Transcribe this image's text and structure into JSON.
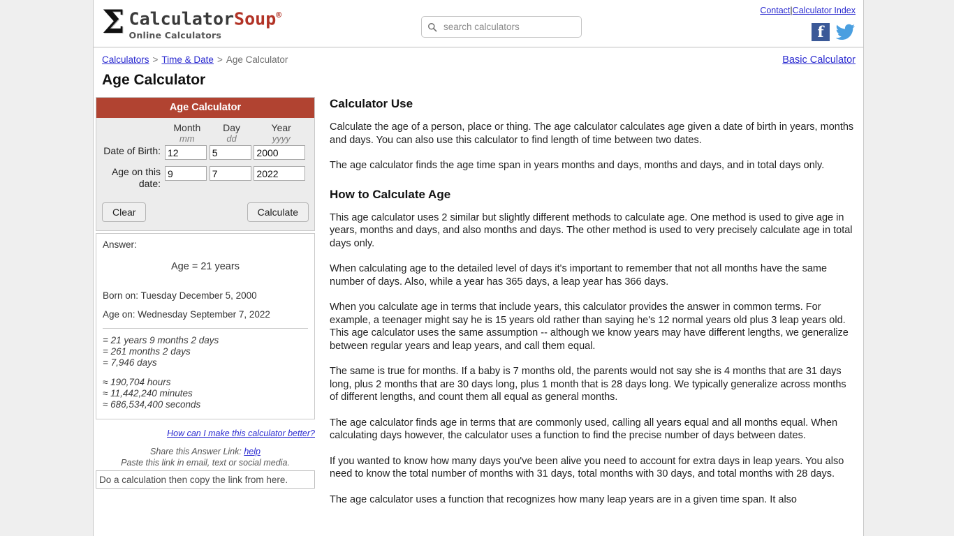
{
  "site": {
    "brand_calc": "Calculator",
    "brand_soup": "Soup",
    "brand_reg": "®",
    "tagline": "Online Calculators",
    "sigma": "Σ",
    "accent_color": "#b14331",
    "link_color": "#2a2ad0"
  },
  "search": {
    "placeholder": "search calculators",
    "value": "",
    "icon": "search-icon"
  },
  "top_links": {
    "contact": "Contact",
    "separator": "|",
    "calculator_index": "Calculator Index"
  },
  "social": {
    "facebook": "f",
    "facebook_name": "facebook-icon",
    "twitter_name": "twitter-icon"
  },
  "breadcrumb": {
    "calculators": "Calculators",
    "sep1": ">",
    "time_and_date": "Time & Date",
    "sep2": ">",
    "current": "Age Calculator"
  },
  "basic_calculator_link": "Basic Calculator",
  "page_title": "Age Calculator",
  "calculator": {
    "panel_title": "Age Calculator",
    "headers": [
      {
        "main": "Month",
        "sub": "mm"
      },
      {
        "main": "Day",
        "sub": "dd"
      },
      {
        "main": "Year",
        "sub": "yyyy"
      }
    ],
    "rows": [
      {
        "label": "Date of Birth:",
        "month": "12",
        "day": "5",
        "year": "2000"
      },
      {
        "label": "Age on this date:",
        "month": "9",
        "day": "7",
        "year": "2022"
      }
    ],
    "clear_label": "Clear",
    "calculate_label": "Calculate"
  },
  "answer": {
    "label": "Answer:",
    "headline": "Age = 21 years",
    "born_on": "Born on: Tuesday December 5, 2000",
    "age_on": "Age on:  Wednesday September 7, 2022",
    "equalities": [
      "= 21 years 9 months 2 days",
      "= 261 months 2 days",
      "= 7,946 days"
    ],
    "approximations": [
      "≈ 190,704 hours",
      "≈ 11,442,240 minutes",
      "≈ 686,534,400 seconds"
    ]
  },
  "feedback_link": "How can I make this calculator better?",
  "share": {
    "line1_text": "Share this Answer Link:",
    "line1_help": "help",
    "line2": "Paste this link in email, text or social media.",
    "input_value": "Do a calculation then copy the link from here."
  },
  "content": {
    "heading_use": "Calculator Use",
    "p1": "Calculate the age of a person, place or thing. The age calculator calculates age given a date of birth in years, months and days. You can also use this calculator to find length of time between two dates.",
    "p2": "The age calculator finds the age time span in years months and days, months and days, and in total days only.",
    "heading_how": "How to Calculate Age",
    "p3": "This age calculator uses 2 similar but slightly different methods to calculate age. One method is used to give age in years, months and days, and also months and days. The other method is used to very precisely calculate age in total days only.",
    "p4": "When calculating age to the detailed level of days it's important to remember that not all months have the same number of days. Also, while a year has 365 days, a leap year has 366 days.",
    "p5": "When you calculate age in terms that include years, this calculator provides the answer in common terms. For example, a teenager might say he is 15 years old rather than saying he's 12 normal years old plus 3 leap years old. This age calculator uses the same assumption -- although we know years may have different lengths, we generalize between regular years and leap years, and call them equal.",
    "p6": "The same is true for months. If a baby is 7 months old, the parents would not say she is 4 months that are 31 days long, plus 2 months that are 30 days long, plus 1 month that is 28 days long. We typically generalize across months of different lengths, and count them all equal as general months.",
    "p7": "The age calculator finds age in terms that are commonly used, calling all years equal and all months equal. When calculating days however, the calculator uses a function to find the precise number of days between dates.",
    "p8": "If you wanted to know how many days you've been alive you need to account for extra days in leap years. You also need to know the total number of months with 31 days, total months with 30 days, and total months with 28 days.",
    "p9": "The age calculator uses a function that recognizes how many leap years are in a given time span. It also"
  }
}
